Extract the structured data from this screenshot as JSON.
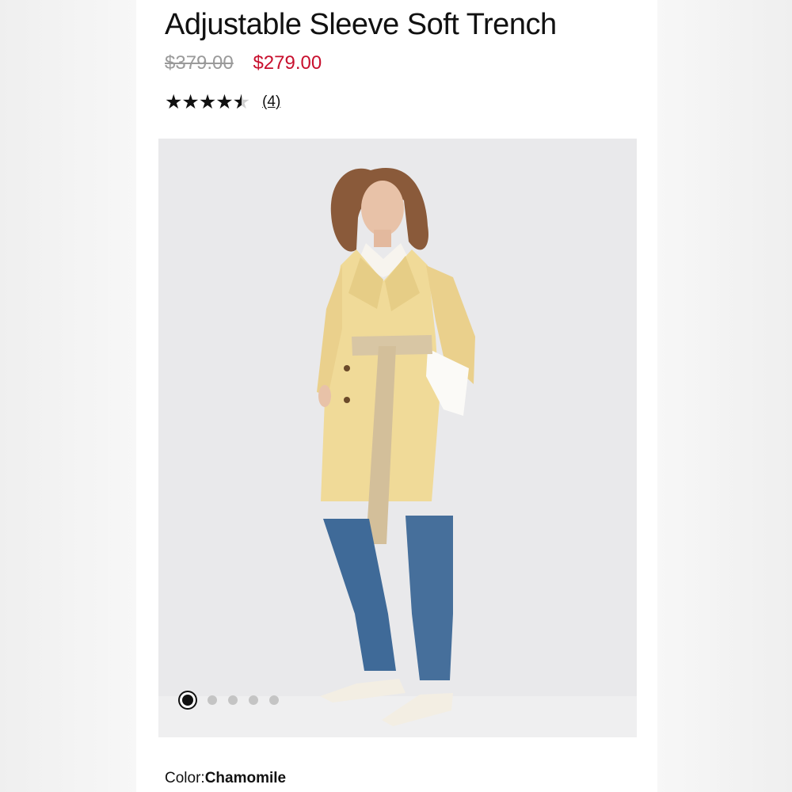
{
  "product": {
    "title": "Adjustable Sleeve Soft Trench",
    "price_original": "$379.00",
    "price_sale": "$279.00",
    "rating": {
      "stars": "★★★★",
      "value": 4.5,
      "max": 5,
      "review_count_label": "(4)"
    },
    "color": {
      "label": "Color:",
      "value": "Chamomile"
    }
  },
  "gallery": {
    "image_count": 5,
    "active_index": 0
  },
  "colors": {
    "sale_price": "#c8102e",
    "coat": "#f0da98",
    "belt": "#d8c6a4",
    "denim": "#3f6a98"
  }
}
